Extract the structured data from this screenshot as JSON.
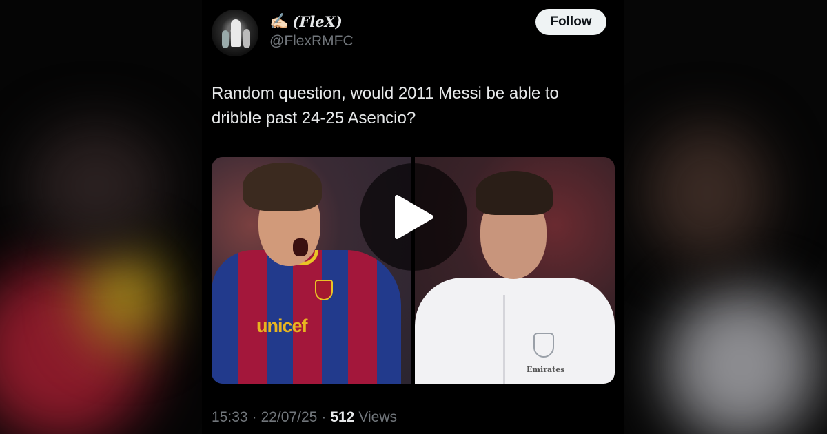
{
  "author": {
    "emoji": "✍🏻",
    "display_name": "(FleX)",
    "handle": "@FlexRMFC"
  },
  "follow_label": "Follow",
  "tweet": {
    "text_line1": "Random question, would 2011 Messi be able to",
    "text_line2": "dribble past 24-25 Asencio?"
  },
  "media": {
    "left_sponsor": "unicef",
    "right_sponsor": "Emirates"
  },
  "meta": {
    "time": "15:33",
    "date": "22/07/25",
    "views_count": "512",
    "views_label": "Views",
    "separator": "·"
  },
  "colors": {
    "background": "#000000",
    "text_primary": "#e7e9ea",
    "text_secondary": "#71767b",
    "follow_bg": "#eff3f4"
  }
}
